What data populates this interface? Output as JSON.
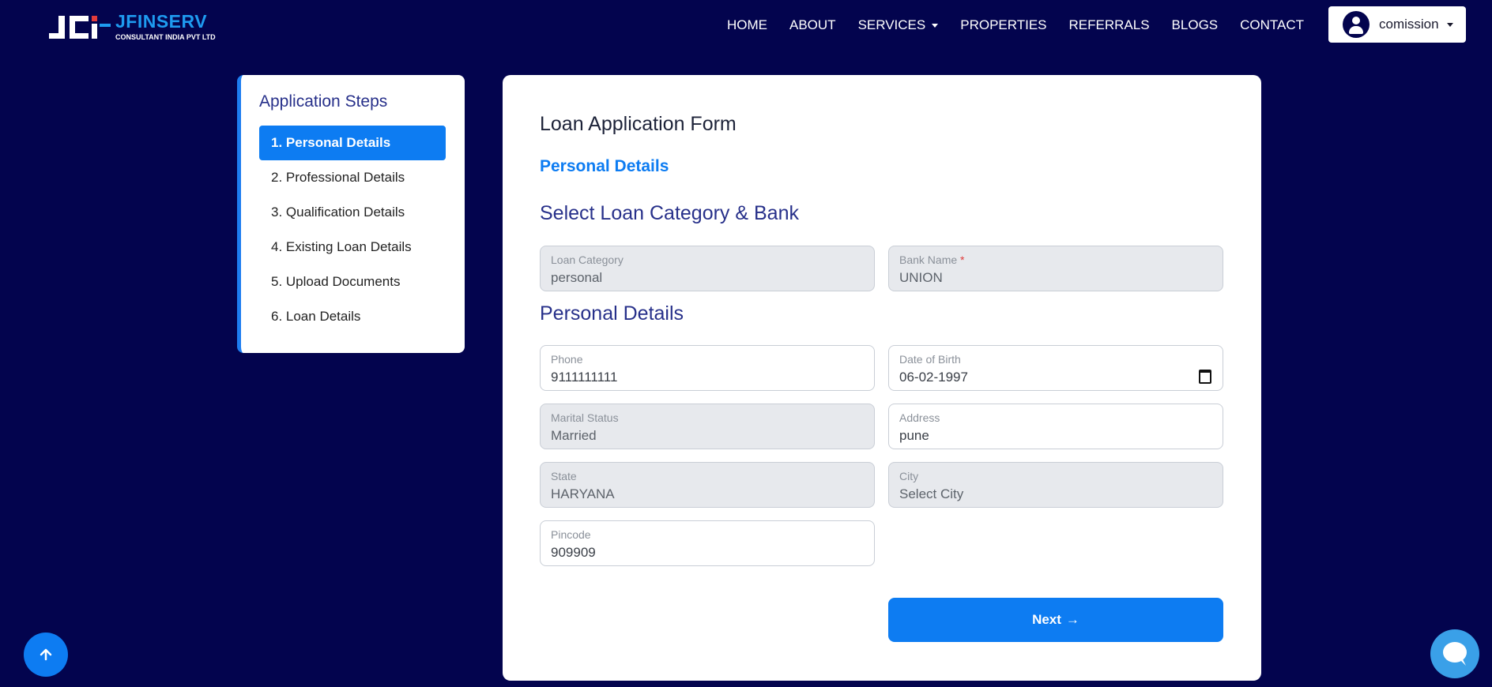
{
  "brand": {
    "name": "JFINSERV",
    "subtitle": "CONSULTANT INDIA PVT LTD"
  },
  "nav": {
    "links": [
      "HOME",
      "ABOUT",
      "SERVICES",
      "PROPERTIES",
      "REFERRALS",
      "BLOGS",
      "CONTACT"
    ],
    "user_name": "comission"
  },
  "sidebar": {
    "title": "Application Steps",
    "steps": [
      "1. Personal Details",
      "2. Professional Details",
      "3. Qualification Details",
      "4. Existing Loan Details",
      "5. Upload Documents",
      "6. Loan Details"
    ],
    "active_step": 0
  },
  "form": {
    "title": "Loan Application Form",
    "step_subtitle": "Personal Details",
    "section_loan": "Select Loan Category & Bank",
    "section_personal": "Personal Details",
    "fields": {
      "loan_category": {
        "label": "Loan Category",
        "value": "personal"
      },
      "bank_name": {
        "label": "Bank Name",
        "required_mark": "*",
        "value": "UNION"
      },
      "phone": {
        "label": "Phone",
        "value": "9111111111"
      },
      "dob": {
        "label": "Date of Birth",
        "value": "06-02-1997"
      },
      "marital_status": {
        "label": "Marital Status",
        "value": "Married"
      },
      "address": {
        "label": "Address",
        "value": "pune"
      },
      "state": {
        "label": "State",
        "value": "HARYANA"
      },
      "city": {
        "label": "City",
        "value": "Select City"
      },
      "pincode": {
        "label": "Pincode",
        "value": "909909"
      }
    },
    "next_label": "Next",
    "next_arrow": "→"
  },
  "colors": {
    "background": "#03044e",
    "accent": "#0d7cf2",
    "heading": "#27308a",
    "brand": "#1e9bf0"
  }
}
